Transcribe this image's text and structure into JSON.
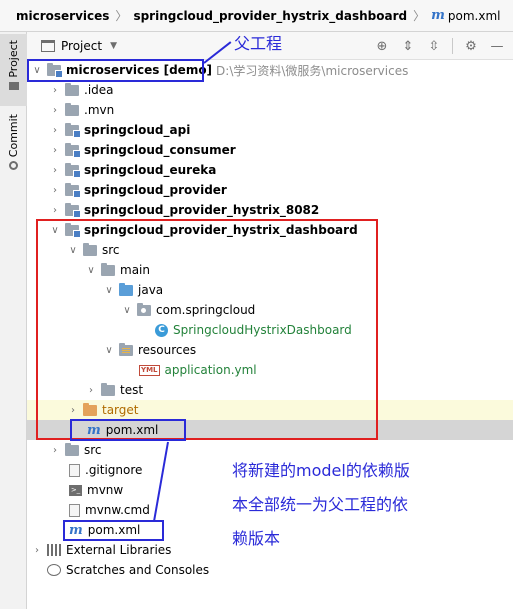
{
  "breadcrumb": {
    "root": "microservices",
    "module": "springcloud_provider_hystrix_dashboard",
    "file": "pom.xml"
  },
  "side_tabs": {
    "project": "Project",
    "commit": "Commit"
  },
  "project_panel": {
    "title": "Project",
    "tools": [
      "target-icon",
      "expand-all-icon",
      "collapse-all-icon",
      "gear-icon",
      "minimize-icon"
    ]
  },
  "tree": {
    "root_name": "microservices [demo]",
    "root_path": "D:\\学习资料\\微服务\\microservices",
    "idea": ".idea",
    "mvn": ".mvn",
    "api": "springcloud_api",
    "consumer": "springcloud_consumer",
    "eureka": "springcloud_eureka",
    "provider": "springcloud_provider",
    "provider_hystrix": "springcloud_provider_hystrix_8082",
    "dashboard": "springcloud_provider_hystrix_dashboard",
    "src": "src",
    "main": "main",
    "java": "java",
    "package": "com.springcloud",
    "class": "SpringcloudHystrixDashboard",
    "resources": "resources",
    "application": "application.yml",
    "test": "test",
    "target": "target",
    "module_pom": "pom.xml",
    "root_src": "src",
    "gitignore": ".gitignore",
    "mvnw": "mvnw",
    "mvnw_cmd": "mvnw.cmd",
    "root_pom": "pom.xml",
    "external_libraries": "External Libraries",
    "scratches": "Scratches and Consoles"
  },
  "annotations": {
    "parent_label": "父工程",
    "note_line1": "将新建的model的依赖版",
    "note_line2": "本全部统一为父工程的依",
    "note_line3": "赖版本"
  },
  "colors": {
    "annotation_blue": "#2a2ad8",
    "annotation_red": "#e02020",
    "selection": "#d5d5d5",
    "highlight": "#fbfadc",
    "class_green": "#23823a"
  }
}
